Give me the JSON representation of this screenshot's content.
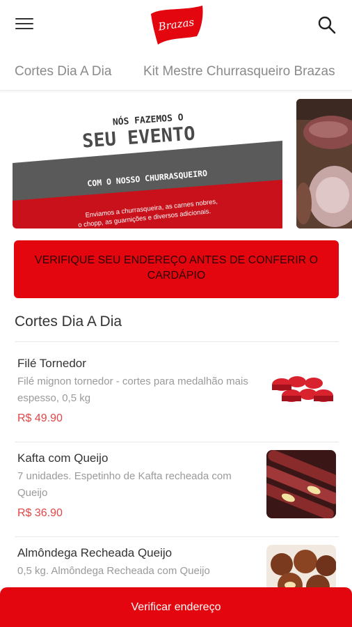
{
  "header": {
    "logo_text": "Brazas",
    "menu_icon": "menu-icon",
    "search_icon": "search-icon"
  },
  "tabs": [
    {
      "label": "Cortes Dia A Dia"
    },
    {
      "label": "Kit Mestre Churrasqueiro Brazas"
    }
  ],
  "banner": {
    "line1": "NÓS FAZEMOS O",
    "line2": "SEU EVENTO",
    "line3": "COM O NOSSO CHURRASQUEIRO",
    "line4": "Enviamos a churrasqueira, as carnes nobres,",
    "line5": "o chopp, as guarnições e diversos adicionais."
  },
  "alert": {
    "text": "VERIFIQUE SEU ENDEREÇO ANTES DE CONFERIR O CARDÁPIO"
  },
  "section": {
    "title": "Cortes Dia A Dia"
  },
  "items": [
    {
      "name": "Filé Tornedor",
      "desc": "Filé mignon tornedor - cortes para medalhão mais espesso, 0,5 kg",
      "price": "R$ 49.90"
    },
    {
      "name": "Kafta com Queijo",
      "desc": "7 unidades. Espetinho de Kafta recheada com Queijo",
      "price": "R$ 36.90"
    },
    {
      "name": "Almôndega Recheada Queijo",
      "desc": "0,5 kg. Almôndega Recheada com Queijo",
      "price": ""
    }
  ],
  "cta": {
    "label": "Verificar endereço"
  },
  "colors": {
    "brand_red": "#e3060f",
    "price_red": "#e14646"
  }
}
